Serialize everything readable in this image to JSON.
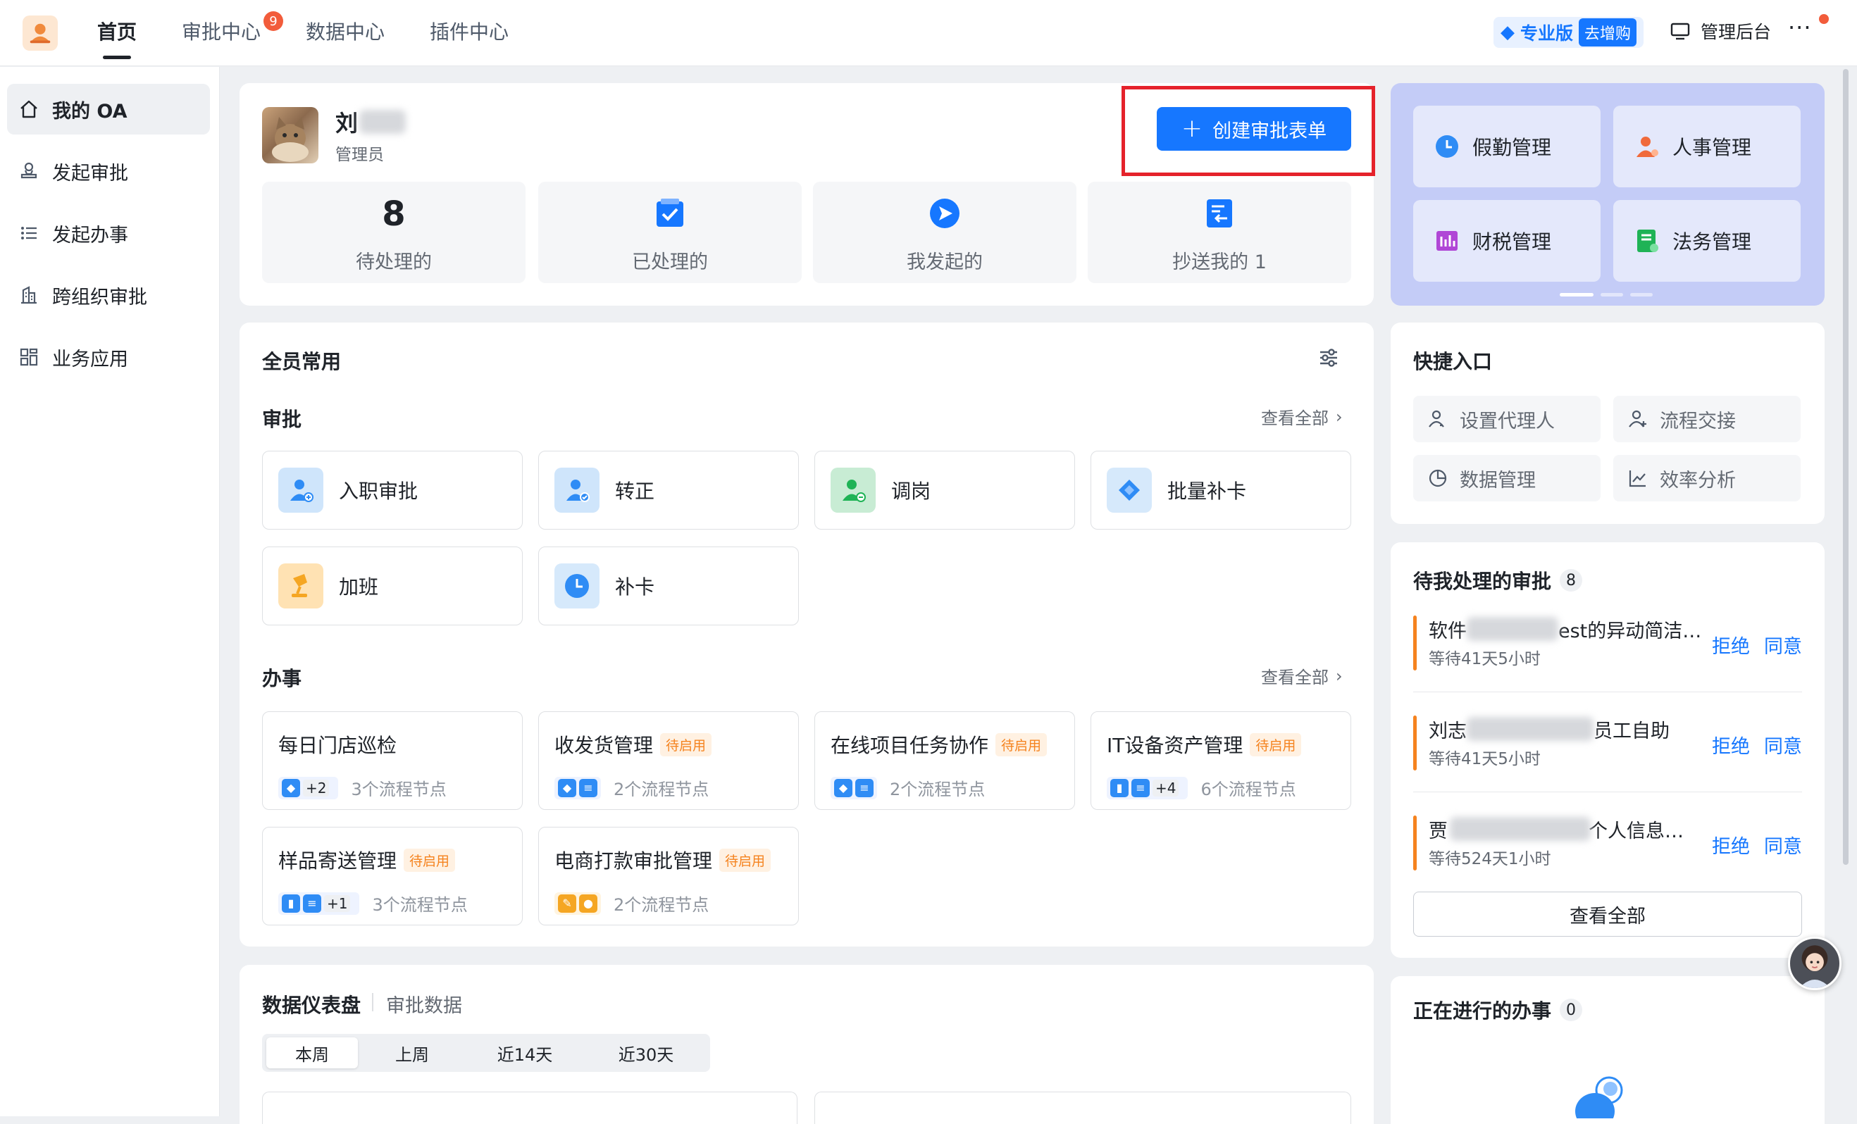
{
  "nav": {
    "tabs": [
      {
        "label": "首页"
      },
      {
        "label": "审批中心",
        "badge": "9"
      },
      {
        "label": "数据中心"
      },
      {
        "label": "插件中心"
      }
    ],
    "pro_label": "专业版",
    "pro_buy": "去增购",
    "admin_label": "管理后台",
    "more": "···"
  },
  "sidebar": {
    "items": [
      {
        "label": "我的 OA",
        "icon": "home-icon",
        "active": true
      },
      {
        "label": "发起审批",
        "icon": "stamp-icon"
      },
      {
        "label": "发起办事",
        "icon": "list-icon"
      },
      {
        "label": "跨组织审批",
        "icon": "building-icon"
      },
      {
        "label": "业务应用",
        "icon": "apps-icon"
      }
    ]
  },
  "profile": {
    "name": "刘",
    "role": "管理员",
    "create_button": "创建审批表单"
  },
  "stats": [
    {
      "value": "8",
      "label": "待处理的"
    },
    {
      "label": "已处理的",
      "icon": "check-icon"
    },
    {
      "label": "我发起的",
      "icon": "send-icon"
    },
    {
      "label": "抄送我的 1",
      "icon": "cc-icon"
    }
  ],
  "banner": {
    "items": [
      {
        "label": "假勤管理",
        "icon": "clock-icon",
        "color": "#2f8cf5"
      },
      {
        "label": "人事管理",
        "icon": "person-icon",
        "color": "#f06a3b"
      },
      {
        "label": "财税管理",
        "icon": "chart-icon",
        "color": "#b046d6"
      },
      {
        "label": "法务管理",
        "icon": "document-icon",
        "color": "#1fb356"
      }
    ]
  },
  "common": {
    "title": "全员常用",
    "approval_title": "审批",
    "view_all": "查看全部",
    "approvals": [
      {
        "label": "入职审批",
        "icon": "onboard-icon"
      },
      {
        "label": "转正",
        "icon": "regular-icon"
      },
      {
        "label": "调岗",
        "icon": "transfer-icon"
      },
      {
        "label": "批量补卡",
        "icon": "batch-card-icon"
      },
      {
        "label": "加班",
        "icon": "overtime-icon"
      },
      {
        "label": "补卡",
        "icon": "clock-icon"
      }
    ],
    "tasks_title": "办事",
    "tasks": [
      {
        "name": "每日门店巡检",
        "tag": "",
        "more": "+2",
        "nodes": "3个流程节点"
      },
      {
        "name": "收发货管理",
        "tag": "待启用",
        "more": "",
        "nodes": "2个流程节点"
      },
      {
        "name": "在线项目任务协作",
        "tag": "待启用",
        "more": "",
        "nodes": "2个流程节点"
      },
      {
        "name": "IT设备资产管理",
        "tag": "待启用",
        "more": "+4",
        "nodes": "6个流程节点"
      },
      {
        "name": "样品寄送管理",
        "tag": "待启用",
        "more": "+1",
        "nodes": "3个流程节点"
      },
      {
        "name": "电商打款审批管理",
        "tag": "待启用",
        "more": "",
        "nodes": "2个流程节点"
      }
    ]
  },
  "dashboard": {
    "title": "数据仪表盘",
    "subtitle": "审批数据",
    "periods": [
      "本周",
      "上周",
      "近14天",
      "近30天"
    ]
  },
  "quick": {
    "title": "快捷入口",
    "items": [
      {
        "label": "设置代理人",
        "icon": "proxy-icon"
      },
      {
        "label": "流程交接",
        "icon": "handover-icon"
      },
      {
        "label": "数据管理",
        "icon": "pie-icon"
      },
      {
        "label": "效率分析",
        "icon": "line-chart-icon"
      }
    ]
  },
  "todo": {
    "title": "待我处理的审批",
    "count": "8",
    "reject": "拒绝",
    "agree": "同意",
    "items": [
      {
        "title": "软件",
        "title_tail": "est的异动简洁…",
        "wait": "等待41天5小时"
      },
      {
        "title": "刘志",
        "title_tail": "员工自助",
        "wait": "等待41天5小时"
      },
      {
        "title": "贾",
        "title_tail": "个人信息…",
        "wait": "等待524天1小时"
      }
    ],
    "view_all": "查看全部"
  },
  "ongoing": {
    "title": "正在进行的办事",
    "count": "0"
  },
  "colors": {
    "accent": "#1677ff",
    "pending_tag": "#f5831f",
    "highlight": "#e5222b"
  }
}
